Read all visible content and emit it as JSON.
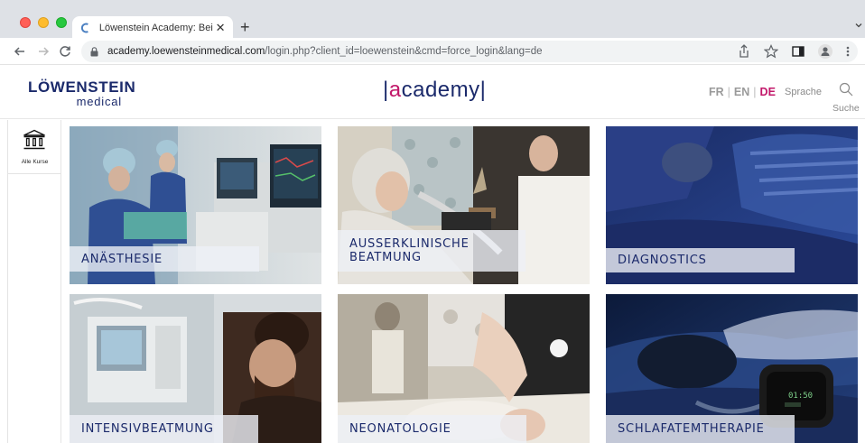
{
  "browser": {
    "tab_title": "Löwenstein Academy: Bei der A",
    "tab_close": "✕",
    "new_tab": "+",
    "url_host": "academy.loewensteinmedical.com",
    "url_path": "/login.php?client_id=loewenstein&cmd=force_login&lang=de",
    "icons": [
      "back-icon",
      "forward-icon",
      "reload-icon",
      "lock-icon",
      "share-icon",
      "star-icon",
      "sidepanel-icon",
      "profile-icon",
      "menu-icon"
    ]
  },
  "header": {
    "logo_main": "LÖWENSTEIN",
    "logo_sub": "medical",
    "academy_bar_left": "|",
    "academy_a": "a",
    "academy_rest": "cademy",
    "academy_bar_right": "|",
    "languages": [
      {
        "code": "FR",
        "active": false
      },
      {
        "code": "EN",
        "active": false
      },
      {
        "code": "DE",
        "active": true
      }
    ],
    "language_label": "Sprache",
    "search_label": "Suche"
  },
  "sidebar": {
    "items": [
      {
        "label": "Alle Kurse",
        "icon": "institution-icon"
      }
    ]
  },
  "courses": [
    {
      "title": "ANÄSTHESIE",
      "lines": [
        "ANÄSTHESIE"
      ]
    },
    {
      "title": "AUSSERKLINISCHE BEATMUNG",
      "lines": [
        "AUSSERKLINISCHE",
        "BEATMUNG"
      ]
    },
    {
      "title": "DIAGNOSTICS",
      "lines": [
        "DIAGNOSTICS"
      ]
    },
    {
      "title": "INTENSIVBEATMUNG",
      "lines": [
        "INTENSIVBEATMUNG"
      ]
    },
    {
      "title": "NEONATOLOGIE",
      "lines": [
        "NEONATOLOGIE"
      ]
    },
    {
      "title": "SCHLAFATEMTHERAPIE",
      "lines": [
        "SCHLAFATEMTHERAPIE"
      ]
    }
  ],
  "device_display": "01:50",
  "colors": {
    "brand_navy": "#1b2a6b",
    "brand_pink": "#c2186a",
    "caption_bg": "#eef0f6"
  }
}
